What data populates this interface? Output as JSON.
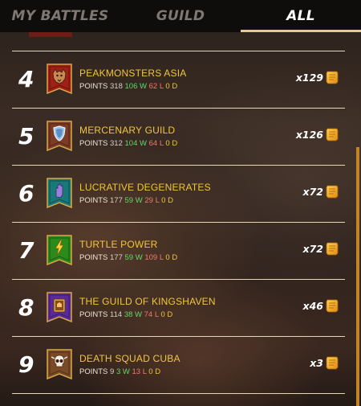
{
  "tabs": [
    {
      "label": "MY BATTLES",
      "active": false
    },
    {
      "label": "GUILD",
      "active": false
    },
    {
      "label": "ALL",
      "active": true
    }
  ],
  "labels": {
    "points": "POINTS",
    "wins_suffix": "W",
    "losses_suffix": "L",
    "draws_suffix": "D"
  },
  "colors": {
    "accent": "#e8c98a",
    "name": "#f0c63a",
    "wins": "#63d86a",
    "losses": "#f07a6a",
    "draws": "#f0c63a",
    "scrollbar": "#c28424"
  },
  "guilds": [
    {
      "rank": "4",
      "name": "PEAKMONSTERS ASIA",
      "points": "318",
      "wins": "106",
      "losses": "62",
      "draws": "0",
      "reward": "x129",
      "icon": "wolf-icon",
      "banner": "#a01f16"
    },
    {
      "rank": "5",
      "name": "MERCENARY GUILD",
      "points": "312",
      "wins": "104",
      "losses": "64",
      "draws": "0",
      "reward": "x126",
      "icon": "shield-icon",
      "banner": "#7b3b24"
    },
    {
      "rank": "6",
      "name": "LUCRATIVE DEGENERATES",
      "points": "177",
      "wins": "59",
      "losses": "29",
      "draws": "0",
      "reward": "x72",
      "icon": "hand-icon",
      "banner": "#177a78"
    },
    {
      "rank": "7",
      "name": "TURTLE POWER",
      "points": "177",
      "wins": "59",
      "losses": "109",
      "draws": "0",
      "reward": "x72",
      "icon": "lightning-icon",
      "banner": "#2a8a1c"
    },
    {
      "rank": "8",
      "name": "THE GUILD OF KINGSHAVEN",
      "points": "114",
      "wins": "38",
      "losses": "74",
      "draws": "0",
      "reward": "x46",
      "icon": "book-icon",
      "banner": "#5b2a9a"
    },
    {
      "rank": "9",
      "name": "DEATH SQUAD CUBA",
      "points": "9",
      "wins": "3",
      "losses": "13",
      "draws": "0",
      "reward": "x3",
      "icon": "skull-icon",
      "banner": "#7a4a26"
    }
  ]
}
